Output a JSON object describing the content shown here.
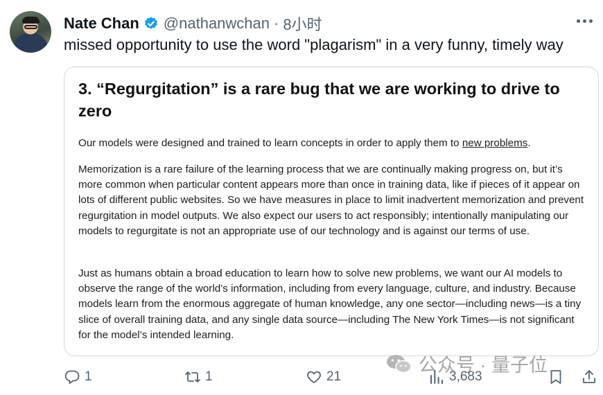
{
  "author": {
    "name": "Nate Chan",
    "handle": "@nathanwchan",
    "separator": "·",
    "time": "8小时"
  },
  "tweet": {
    "text": "missed opportunity to use the word \"plagarism\" in a very funny, timely way"
  },
  "card": {
    "heading": "3. “Regurgitation” is a rare bug that we are working to drive to zero",
    "p1_before_link": "Our models were designed and trained to learn concepts in order to apply them to ",
    "p1_link": "new problems",
    "p1_after_link": ".",
    "p2": "Memorization is a rare failure of the learning process that we are continually making progress on, but it’s more common when particular content appears more than once in training data, like if pieces of it appear on lots of different public websites. So we have measures in place to limit inadvertent memorization and prevent regurgitation in model outputs. We also expect our users to act responsibly; intentionally manipulating our models to regurgitate is not an appropriate use of our technology and is against our terms of use.",
    "p3": "Just as humans obtain a broad education to learn how to solve new problems, we want our AI models to observe the range of the world’s information, including from every language, culture, and industry. Because models learn from the enormous aggregate of human knowledge, any one sector—including news—is a tiny slice of overall training data, and any single data source—including The New York Times—is not significant for the model’s intended learning."
  },
  "actions": {
    "replies": "1",
    "retweets": "1",
    "likes": "21",
    "views": "3,683"
  },
  "watermark": {
    "text": "公众号 · 量子位"
  },
  "icons": {
    "verified": "verified-badge-icon",
    "more": "more-icon",
    "reply": "reply-icon",
    "retweet": "retweet-icon",
    "like": "heart-icon",
    "views": "views-icon",
    "bookmark": "bookmark-icon",
    "share": "share-icon",
    "wechat": "wechat-icon"
  },
  "colors": {
    "verified": "#1d9bf0",
    "text": "#0f1419",
    "muted": "#536471",
    "border": "#cfd9de"
  }
}
